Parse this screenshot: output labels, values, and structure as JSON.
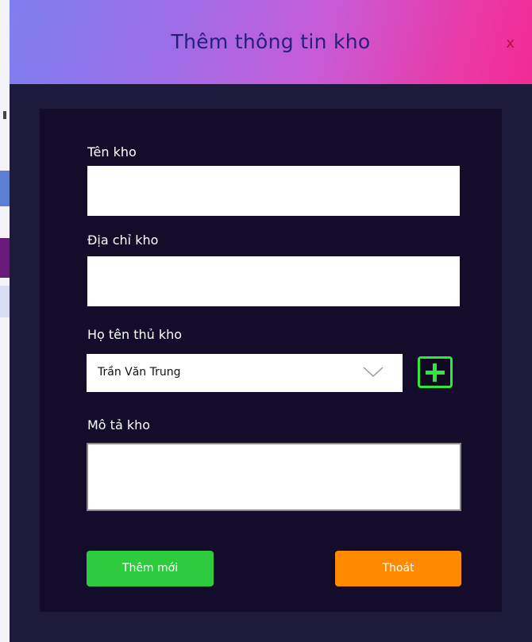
{
  "dialog": {
    "title": "Thêm thông tin kho",
    "close_label": "x"
  },
  "form": {
    "warehouse_name": {
      "label": "Tên kho",
      "value": ""
    },
    "warehouse_address": {
      "label": "Địa chỉ kho",
      "value": ""
    },
    "keeper": {
      "label": "Họ tên thủ kho",
      "selected": "Trần Văn Trung"
    },
    "description": {
      "label": "Mô tả kho",
      "value": ""
    }
  },
  "actions": {
    "add_label": "Thêm mới",
    "exit_label": "Thoát"
  },
  "icons": {
    "add_keeper": "plus-icon",
    "dropdown": "chevron-down-icon"
  },
  "colors": {
    "add_button": "#2fcb3f",
    "exit_button": "#ff8a00",
    "plus_icon": "#2ee83a",
    "panel": "#130d2b"
  }
}
